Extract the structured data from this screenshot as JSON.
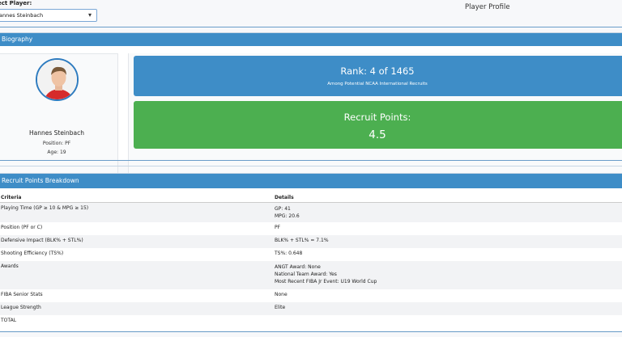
{
  "selector": {
    "label": "ect Player:",
    "value": "annes Steinbach"
  },
  "page_title": "Player Profile",
  "biography": {
    "header": "Biography",
    "name": "Hannes Steinbach",
    "position": "Position: PF",
    "age": "Age: 19",
    "rank_title": "Rank: 4 of 1465",
    "rank_sub": "Among Potential NCAA International Recruits",
    "points_title": "Recruit Points:",
    "points_value": "4.5",
    "colors": {
      "rank": "#3e8dc7",
      "points": "#4caf50"
    }
  },
  "breakdown": {
    "header": "Recruit Points Breakdown",
    "columns": [
      "Criteria",
      "Details"
    ],
    "rows": [
      {
        "criteria": "Playing Time (GP ≥ 10 & MPG ≥ 15)",
        "details": [
          "GP: 41",
          "MPG: 20.6"
        ]
      },
      {
        "criteria": "Position (PF or C)",
        "details": [
          "PF"
        ]
      },
      {
        "criteria": "Defensive Impact (BLK% + STL%)",
        "details": [
          "BLK% + STL% = 7.1%"
        ]
      },
      {
        "criteria": "Shooting Efficiency (TS%)",
        "details": [
          "TS%: 0.648"
        ]
      },
      {
        "criteria": "Awards",
        "details": [
          "ANGT Award: None",
          "National Team Award: Yes",
          "Most Recent FIBA Jr Event: U19 World Cup"
        ]
      },
      {
        "criteria": "FIBA Senior Stats",
        "details": [
          "None"
        ]
      },
      {
        "criteria": "League Strength",
        "details": [
          "Elite"
        ]
      },
      {
        "criteria": "TOTAL",
        "details": [
          ""
        ]
      }
    ]
  }
}
